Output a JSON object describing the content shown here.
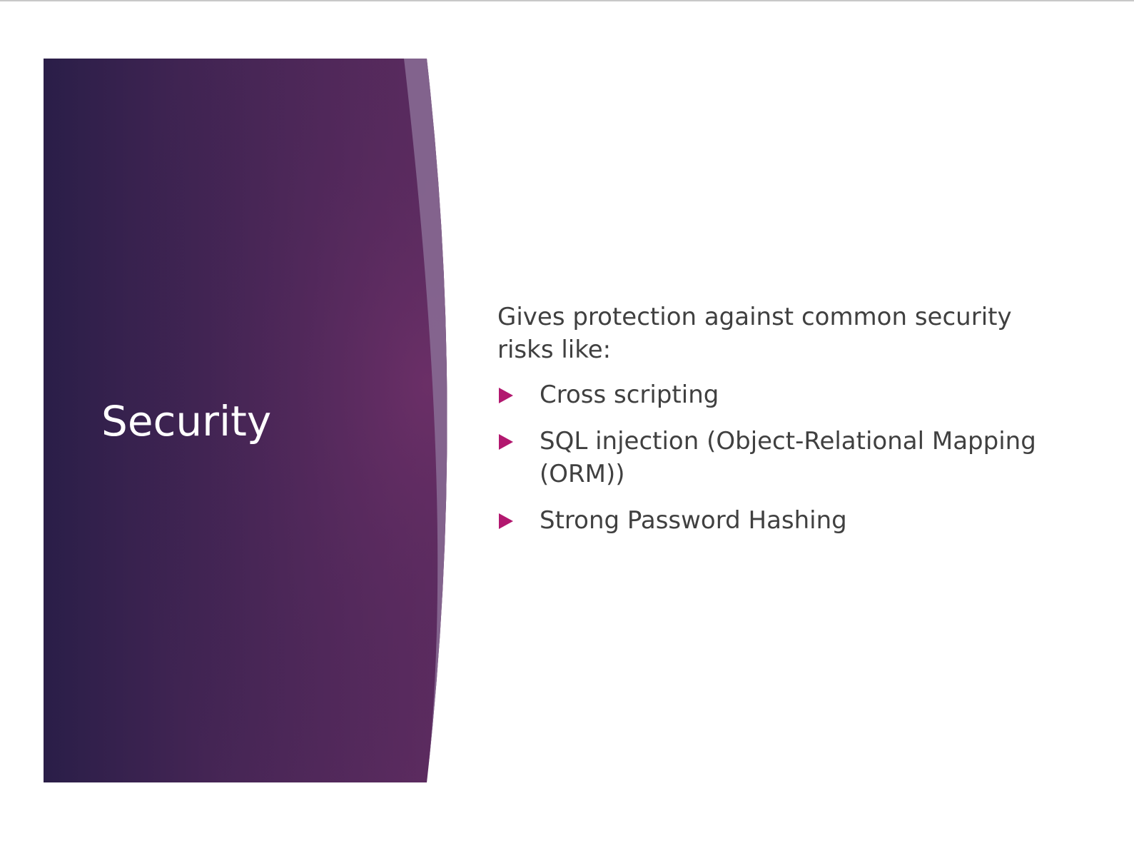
{
  "slide": {
    "title": "Security",
    "intro": "Gives protection against common security risks like:",
    "bullets": [
      "Cross scripting",
      "SQL injection (Object-Relational Mapping (ORM))",
      "Strong Password Hashing"
    ]
  },
  "colors": {
    "panel_dark": "#2a1e48",
    "panel_light": "#6a2f66",
    "bullet_marker": "#b2186f",
    "body_text": "#404040",
    "title_text": "#ffffff"
  },
  "icons": {
    "bullet": "right-triangle-icon"
  }
}
